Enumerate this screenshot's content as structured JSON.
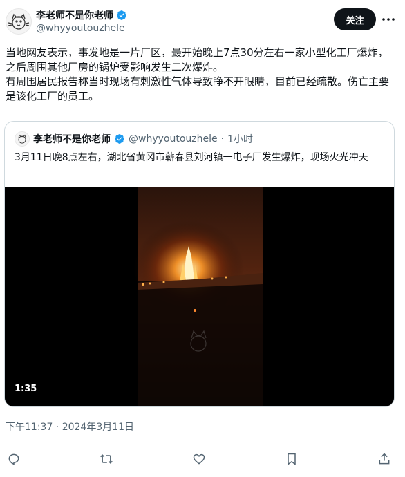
{
  "header": {
    "display_name": "李老师不是你老师",
    "handle": "@whyyoutouzhele",
    "follow_label": "关注"
  },
  "tweet": {
    "text": "当地网友表示，事发地是一片厂区，最开始晚上7点30分左右一家小型化工厂爆炸，之后周围其他厂房的锅炉受影响发生二次爆炸。\n有周围居民报告称当时现场有刺激性气体导致睁不开眼睛，目前已经疏散。伤亡主要是该化工厂的员工。"
  },
  "quoted_tweet": {
    "display_name": "李老师不是你老师",
    "handle": "@whyyoutouzhele",
    "separator": "·",
    "time": "1小时",
    "text": "3月11日晚8点左右，湖北省黄冈市蕲春县刘河镇一电子厂发生爆炸，现场火光冲天",
    "video_duration": "1:35"
  },
  "timestamp": "下午11:37 · 2024年3月11日",
  "colors": {
    "accent_verified": "#1d9bf0",
    "text_primary": "#0f1419",
    "text_secondary": "#536471",
    "border": "#cfd9de"
  },
  "icons": {
    "reply": "reply-icon",
    "retweet": "retweet-icon",
    "like": "like-icon",
    "bookmark": "bookmark-icon",
    "share": "share-icon",
    "more": "more-icon",
    "verified": "verified-badge-icon"
  }
}
